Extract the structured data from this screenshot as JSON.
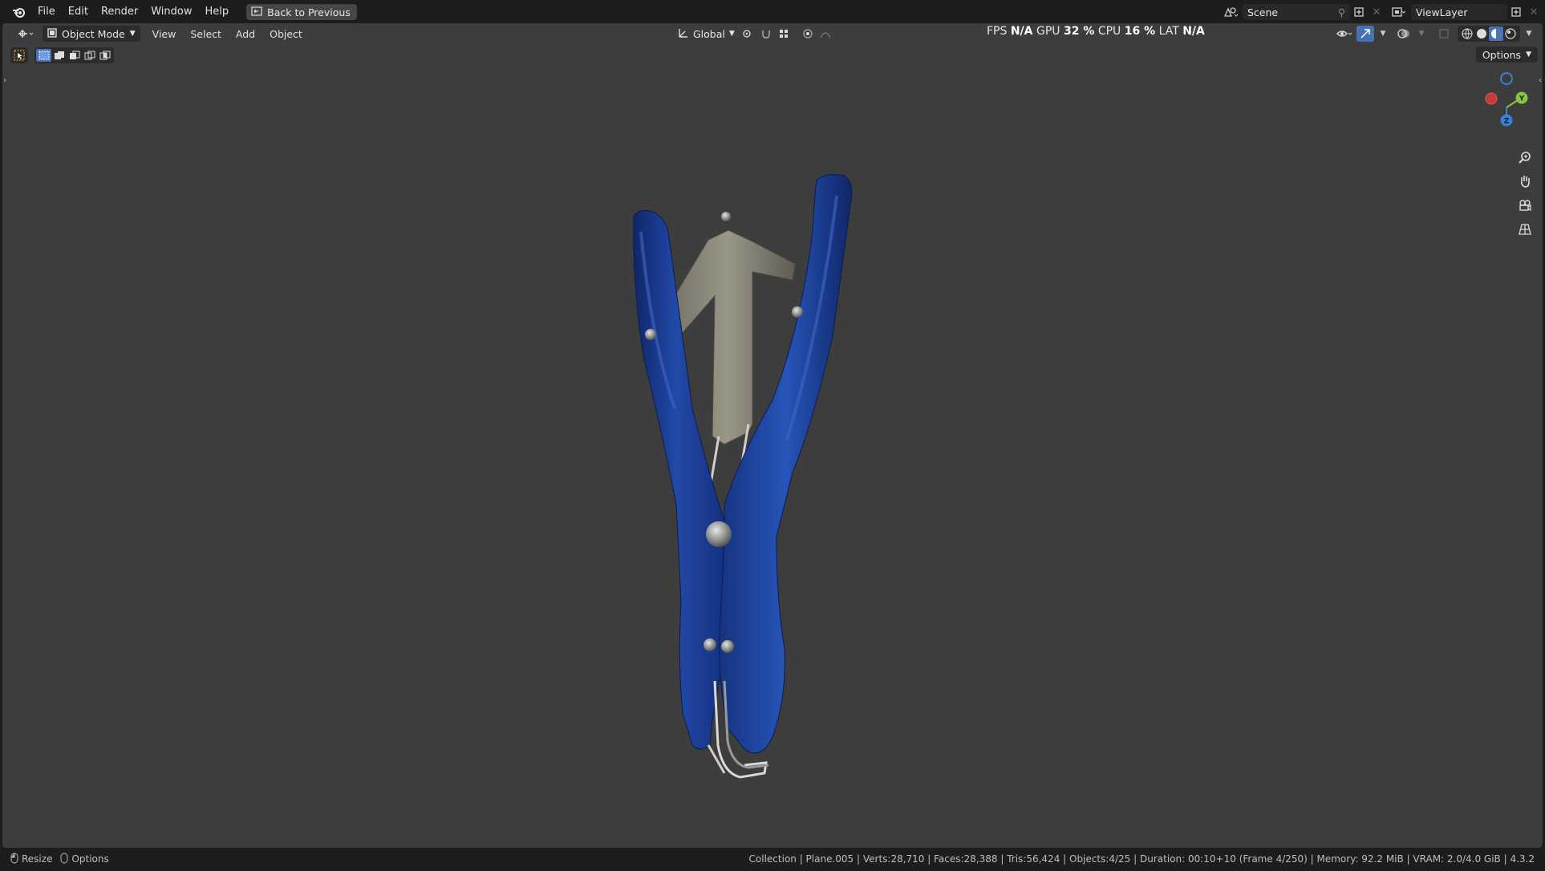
{
  "topbar": {
    "menus": [
      "File",
      "Edit",
      "Render",
      "Window",
      "Help"
    ],
    "back_button": "Back to Previous",
    "scene": "Scene",
    "view_layer": "ViewLayer"
  },
  "viewport_header": {
    "mode": "Object Mode",
    "menus": [
      "View",
      "Select",
      "Add",
      "Object"
    ],
    "orientation": "Global",
    "options": "Options"
  },
  "stats": {
    "fps_label": "FPS",
    "fps_value": "N/A",
    "gpu_label": "GPU",
    "gpu_value": "32 %",
    "cpu_label": "CPU",
    "cpu_value": "16 %",
    "lat_label": "LAT",
    "lat_value": "N/A"
  },
  "gizmo": {
    "y": "Y",
    "z": "Z"
  },
  "statusbar": {
    "left_items": [
      "Resize",
      "Options"
    ],
    "info": "Collection | Plane.005 | Verts:28,710 | Faces:28,388 | Tris:56,424 | Objects:4/25 | Duration: 00:10+10 (Frame 4/250) | Memory: 92.2 MiB | VRAM: 2.0/4.0 GiB | 4.3.2"
  },
  "colors": {
    "handle_blue": "#1e3f95",
    "metal": "#8a8778",
    "viewport_bg": "#3d3d3d",
    "accent": "#4772b3"
  }
}
